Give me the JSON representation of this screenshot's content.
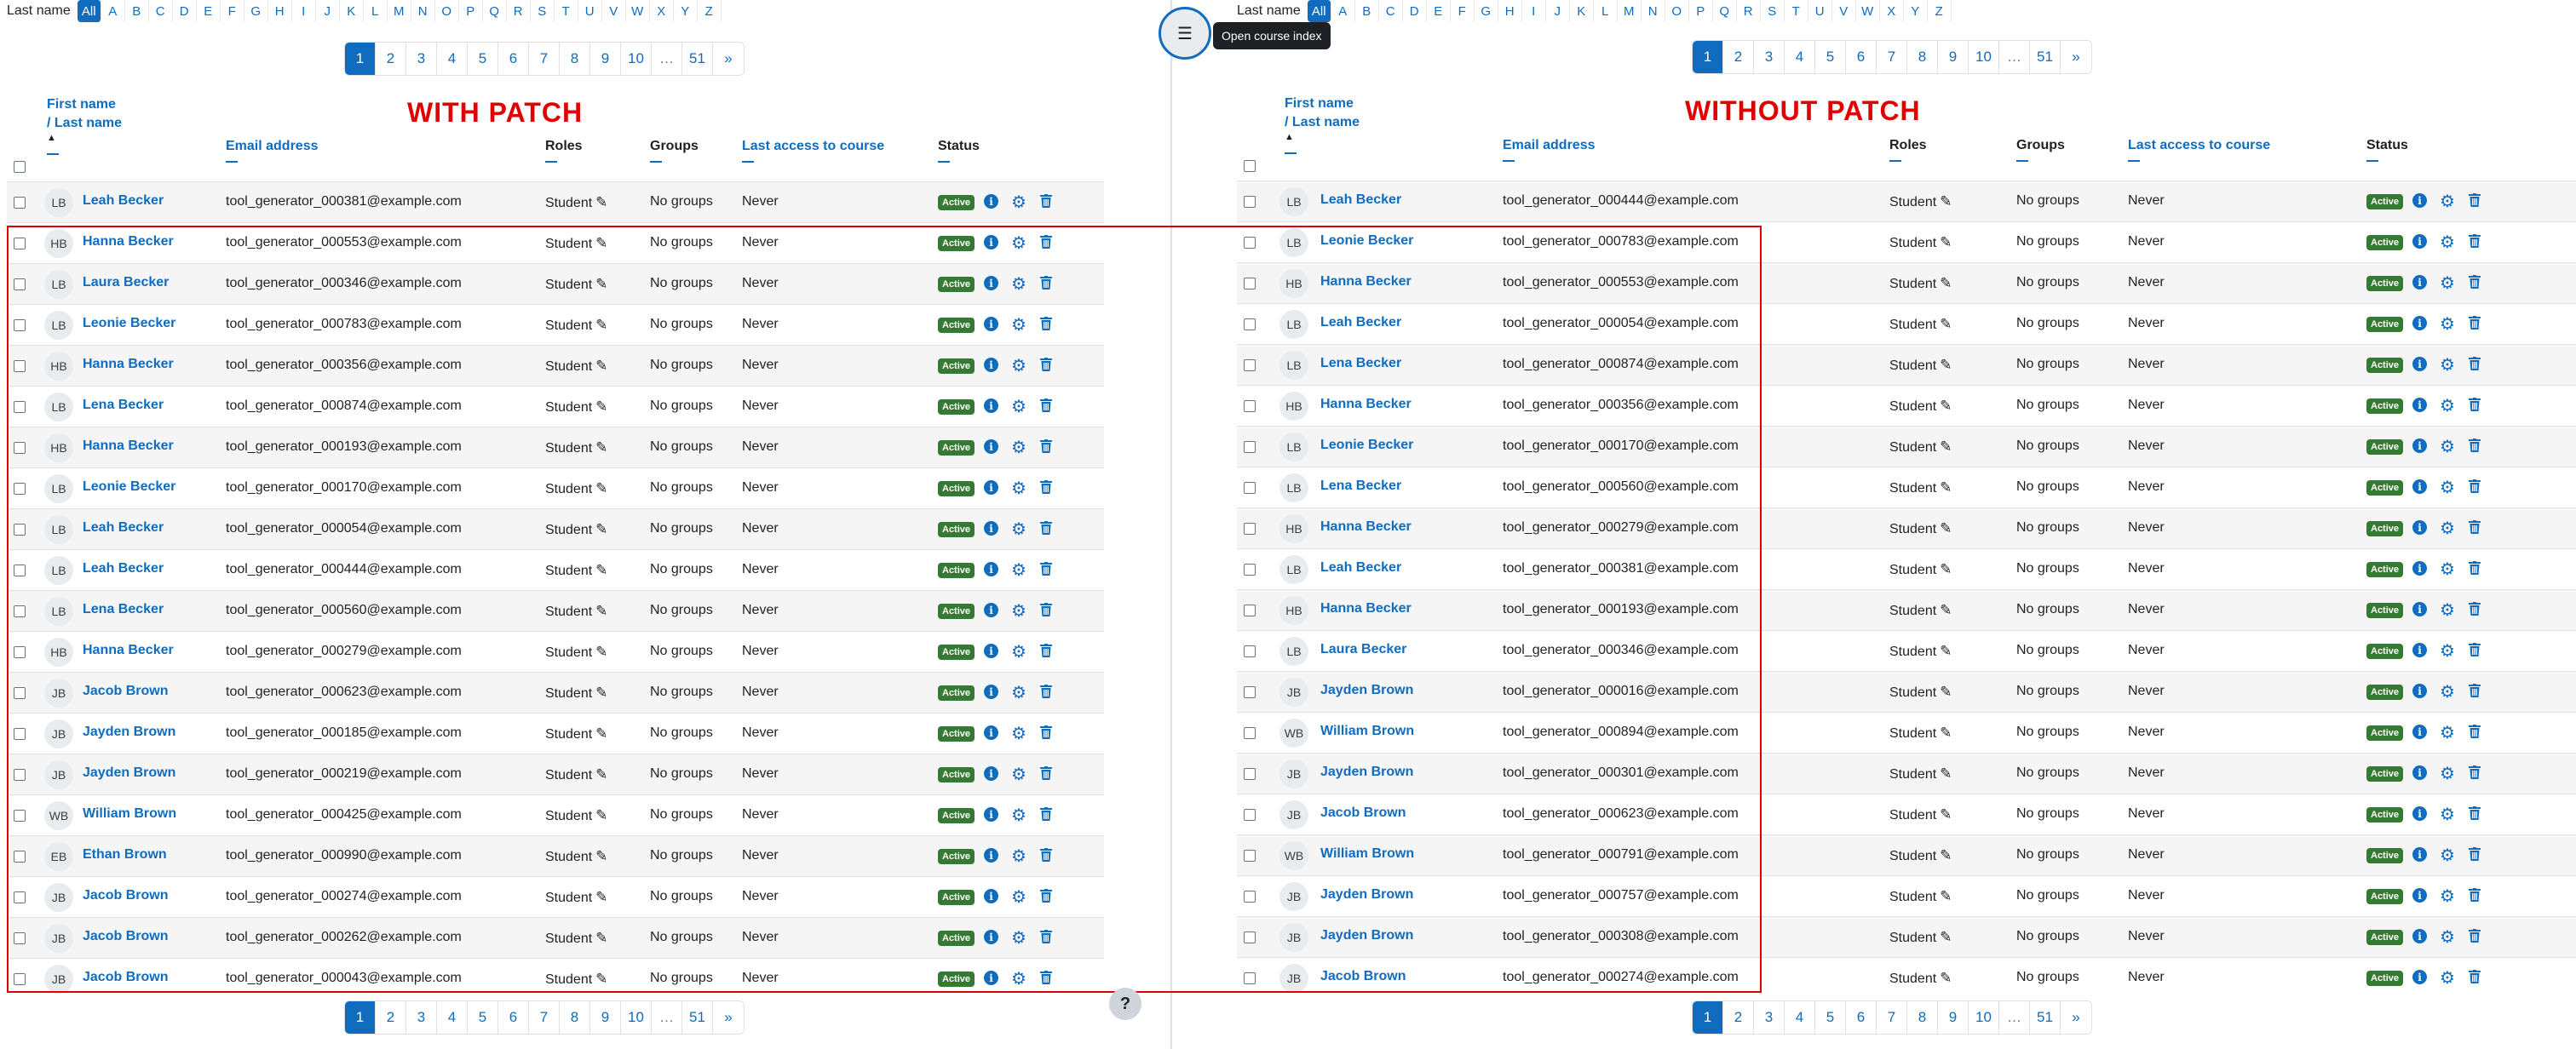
{
  "left": {
    "heading": "WITH PATCH",
    "initials": {
      "label": "Last name",
      "letters": [
        "All",
        "A",
        "B",
        "C",
        "D",
        "E",
        "F",
        "G",
        "H",
        "I",
        "J",
        "K",
        "L",
        "M",
        "N",
        "O",
        "P",
        "Q",
        "R",
        "S",
        "T",
        "U",
        "V",
        "W",
        "X",
        "Y",
        "Z"
      ],
      "active": "All"
    },
    "pagination": [
      "1",
      "2",
      "3",
      "4",
      "5",
      "6",
      "7",
      "8",
      "9",
      "10",
      "…",
      "51",
      "»"
    ],
    "rows": [
      {
        "initials": "LB",
        "name": "Leah Becker",
        "email": "tool_generator_000381@example.com"
      },
      {
        "initials": "HB",
        "name": "Hanna Becker",
        "email": "tool_generator_000553@example.com"
      },
      {
        "initials": "LB",
        "name": "Laura Becker",
        "email": "tool_generator_000346@example.com"
      },
      {
        "initials": "LB",
        "name": "Leonie Becker",
        "email": "tool_generator_000783@example.com"
      },
      {
        "initials": "HB",
        "name": "Hanna Becker",
        "email": "tool_generator_000356@example.com"
      },
      {
        "initials": "LB",
        "name": "Lena Becker",
        "email": "tool_generator_000874@example.com"
      },
      {
        "initials": "HB",
        "name": "Hanna Becker",
        "email": "tool_generator_000193@example.com"
      },
      {
        "initials": "LB",
        "name": "Leonie Becker",
        "email": "tool_generator_000170@example.com"
      },
      {
        "initials": "LB",
        "name": "Leah Becker",
        "email": "tool_generator_000054@example.com"
      },
      {
        "initials": "LB",
        "name": "Leah Becker",
        "email": "tool_generator_000444@example.com"
      },
      {
        "initials": "LB",
        "name": "Lena Becker",
        "email": "tool_generator_000560@example.com"
      },
      {
        "initials": "HB",
        "name": "Hanna Becker",
        "email": "tool_generator_000279@example.com"
      },
      {
        "initials": "JB",
        "name": "Jacob Brown",
        "email": "tool_generator_000623@example.com"
      },
      {
        "initials": "JB",
        "name": "Jayden Brown",
        "email": "tool_generator_000185@example.com"
      },
      {
        "initials": "JB",
        "name": "Jayden Brown",
        "email": "tool_generator_000219@example.com"
      },
      {
        "initials": "WB",
        "name": "William Brown",
        "email": "tool_generator_000425@example.com"
      },
      {
        "initials": "EB",
        "name": "Ethan Brown",
        "email": "tool_generator_000990@example.com"
      },
      {
        "initials": "JB",
        "name": "Jacob Brown",
        "email": "tool_generator_000274@example.com"
      },
      {
        "initials": "JB",
        "name": "Jacob Brown",
        "email": "tool_generator_000262@example.com"
      },
      {
        "initials": "JB",
        "name": "Jacob Brown",
        "email": "tool_generator_000043@example.com"
      }
    ]
  },
  "right": {
    "heading": "WITHOUT PATCH",
    "initials": {
      "label": "Last name",
      "letters": [
        "All",
        "A",
        "B",
        "C",
        "D",
        "E",
        "F",
        "G",
        "H",
        "I",
        "J",
        "K",
        "L",
        "M",
        "N",
        "O",
        "P",
        "Q",
        "R",
        "S",
        "T",
        "U",
        "V",
        "W",
        "X",
        "Y",
        "Z"
      ],
      "active": "All"
    },
    "pagination": [
      "1",
      "2",
      "3",
      "4",
      "5",
      "6",
      "7",
      "8",
      "9",
      "10",
      "…",
      "51",
      "»"
    ],
    "rows": [
      {
        "initials": "LB",
        "name": "Leah Becker",
        "email": "tool_generator_000444@example.com"
      },
      {
        "initials": "LB",
        "name": "Leonie Becker",
        "email": "tool_generator_000783@example.com"
      },
      {
        "initials": "HB",
        "name": "Hanna Becker",
        "email": "tool_generator_000553@example.com"
      },
      {
        "initials": "LB",
        "name": "Leah Becker",
        "email": "tool_generator_000054@example.com"
      },
      {
        "initials": "LB",
        "name": "Lena Becker",
        "email": "tool_generator_000874@example.com"
      },
      {
        "initials": "HB",
        "name": "Hanna Becker",
        "email": "tool_generator_000356@example.com"
      },
      {
        "initials": "LB",
        "name": "Leonie Becker",
        "email": "tool_generator_000170@example.com"
      },
      {
        "initials": "LB",
        "name": "Lena Becker",
        "email": "tool_generator_000560@example.com"
      },
      {
        "initials": "HB",
        "name": "Hanna Becker",
        "email": "tool_generator_000279@example.com"
      },
      {
        "initials": "LB",
        "name": "Leah Becker",
        "email": "tool_generator_000381@example.com"
      },
      {
        "initials": "HB",
        "name": "Hanna Becker",
        "email": "tool_generator_000193@example.com"
      },
      {
        "initials": "LB",
        "name": "Laura Becker",
        "email": "tool_generator_000346@example.com"
      },
      {
        "initials": "JB",
        "name": "Jayden Brown",
        "email": "tool_generator_000016@example.com"
      },
      {
        "initials": "WB",
        "name": "William Brown",
        "email": "tool_generator_000894@example.com"
      },
      {
        "initials": "JB",
        "name": "Jayden Brown",
        "email": "tool_generator_000301@example.com"
      },
      {
        "initials": "JB",
        "name": "Jacob Brown",
        "email": "tool_generator_000623@example.com"
      },
      {
        "initials": "WB",
        "name": "William Brown",
        "email": "tool_generator_000791@example.com"
      },
      {
        "initials": "JB",
        "name": "Jayden Brown",
        "email": "tool_generator_000757@example.com"
      },
      {
        "initials": "JB",
        "name": "Jayden Brown",
        "email": "tool_generator_000308@example.com"
      },
      {
        "initials": "JB",
        "name": "Jacob Brown",
        "email": "tool_generator_000274@example.com"
      }
    ]
  },
  "columns": {
    "first_name": "First name",
    "last_name": "/ Last name",
    "email": "Email address",
    "roles": "Roles",
    "groups": "Groups",
    "last_access": "Last access to course",
    "status": "Status"
  },
  "row_defaults": {
    "role": "Student",
    "groups": "No groups",
    "last_access": "Never",
    "status": "Active"
  },
  "course_index_tooltip": "Open course index",
  "help_label": "?",
  "colors": {
    "link": "#0f6cbf",
    "active_badge": "#357a32",
    "annotation": "#e00000"
  },
  "icons": [
    "pencil-icon",
    "info-icon",
    "gear-icon",
    "trash-icon",
    "sort-asc-icon",
    "course-index-icon",
    "help-icon"
  ]
}
